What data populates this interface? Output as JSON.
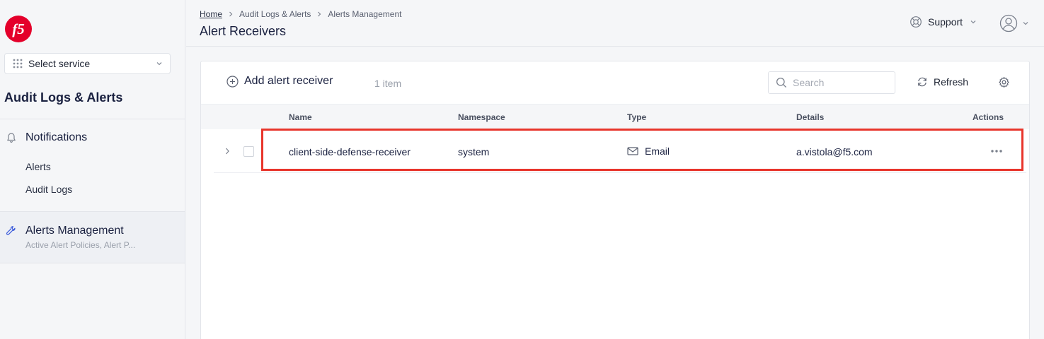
{
  "sidebar": {
    "service_select": "Select service",
    "title": "Audit Logs & Alerts",
    "groups": [
      {
        "label": "Notifications",
        "icon": "bell-icon",
        "items": [
          {
            "label": "Alerts"
          },
          {
            "label": "Audit Logs"
          }
        ]
      },
      {
        "label": "Alerts Management",
        "icon": "wrench-icon",
        "subtitle": "Active Alert Policies, Alert P..."
      }
    ]
  },
  "header": {
    "breadcrumb": [
      "Home",
      "Audit Logs & Alerts",
      "Alerts Management"
    ],
    "title": "Alert Receivers",
    "support_label": "Support"
  },
  "toolbar": {
    "add_label": "Add alert receiver",
    "count": "1 item",
    "search_placeholder": "Search",
    "refresh_label": "Refresh"
  },
  "table": {
    "columns": [
      "Name",
      "Namespace",
      "Type",
      "Details",
      "Actions"
    ],
    "rows": [
      {
        "name": "client-side-defense-receiver",
        "namespace": "system",
        "type": "Email",
        "details": "a.vistola@f5.com"
      }
    ]
  },
  "colors": {
    "brand": "#e4002b",
    "highlight": "#e8352b",
    "accent": "#3b5bdb"
  }
}
